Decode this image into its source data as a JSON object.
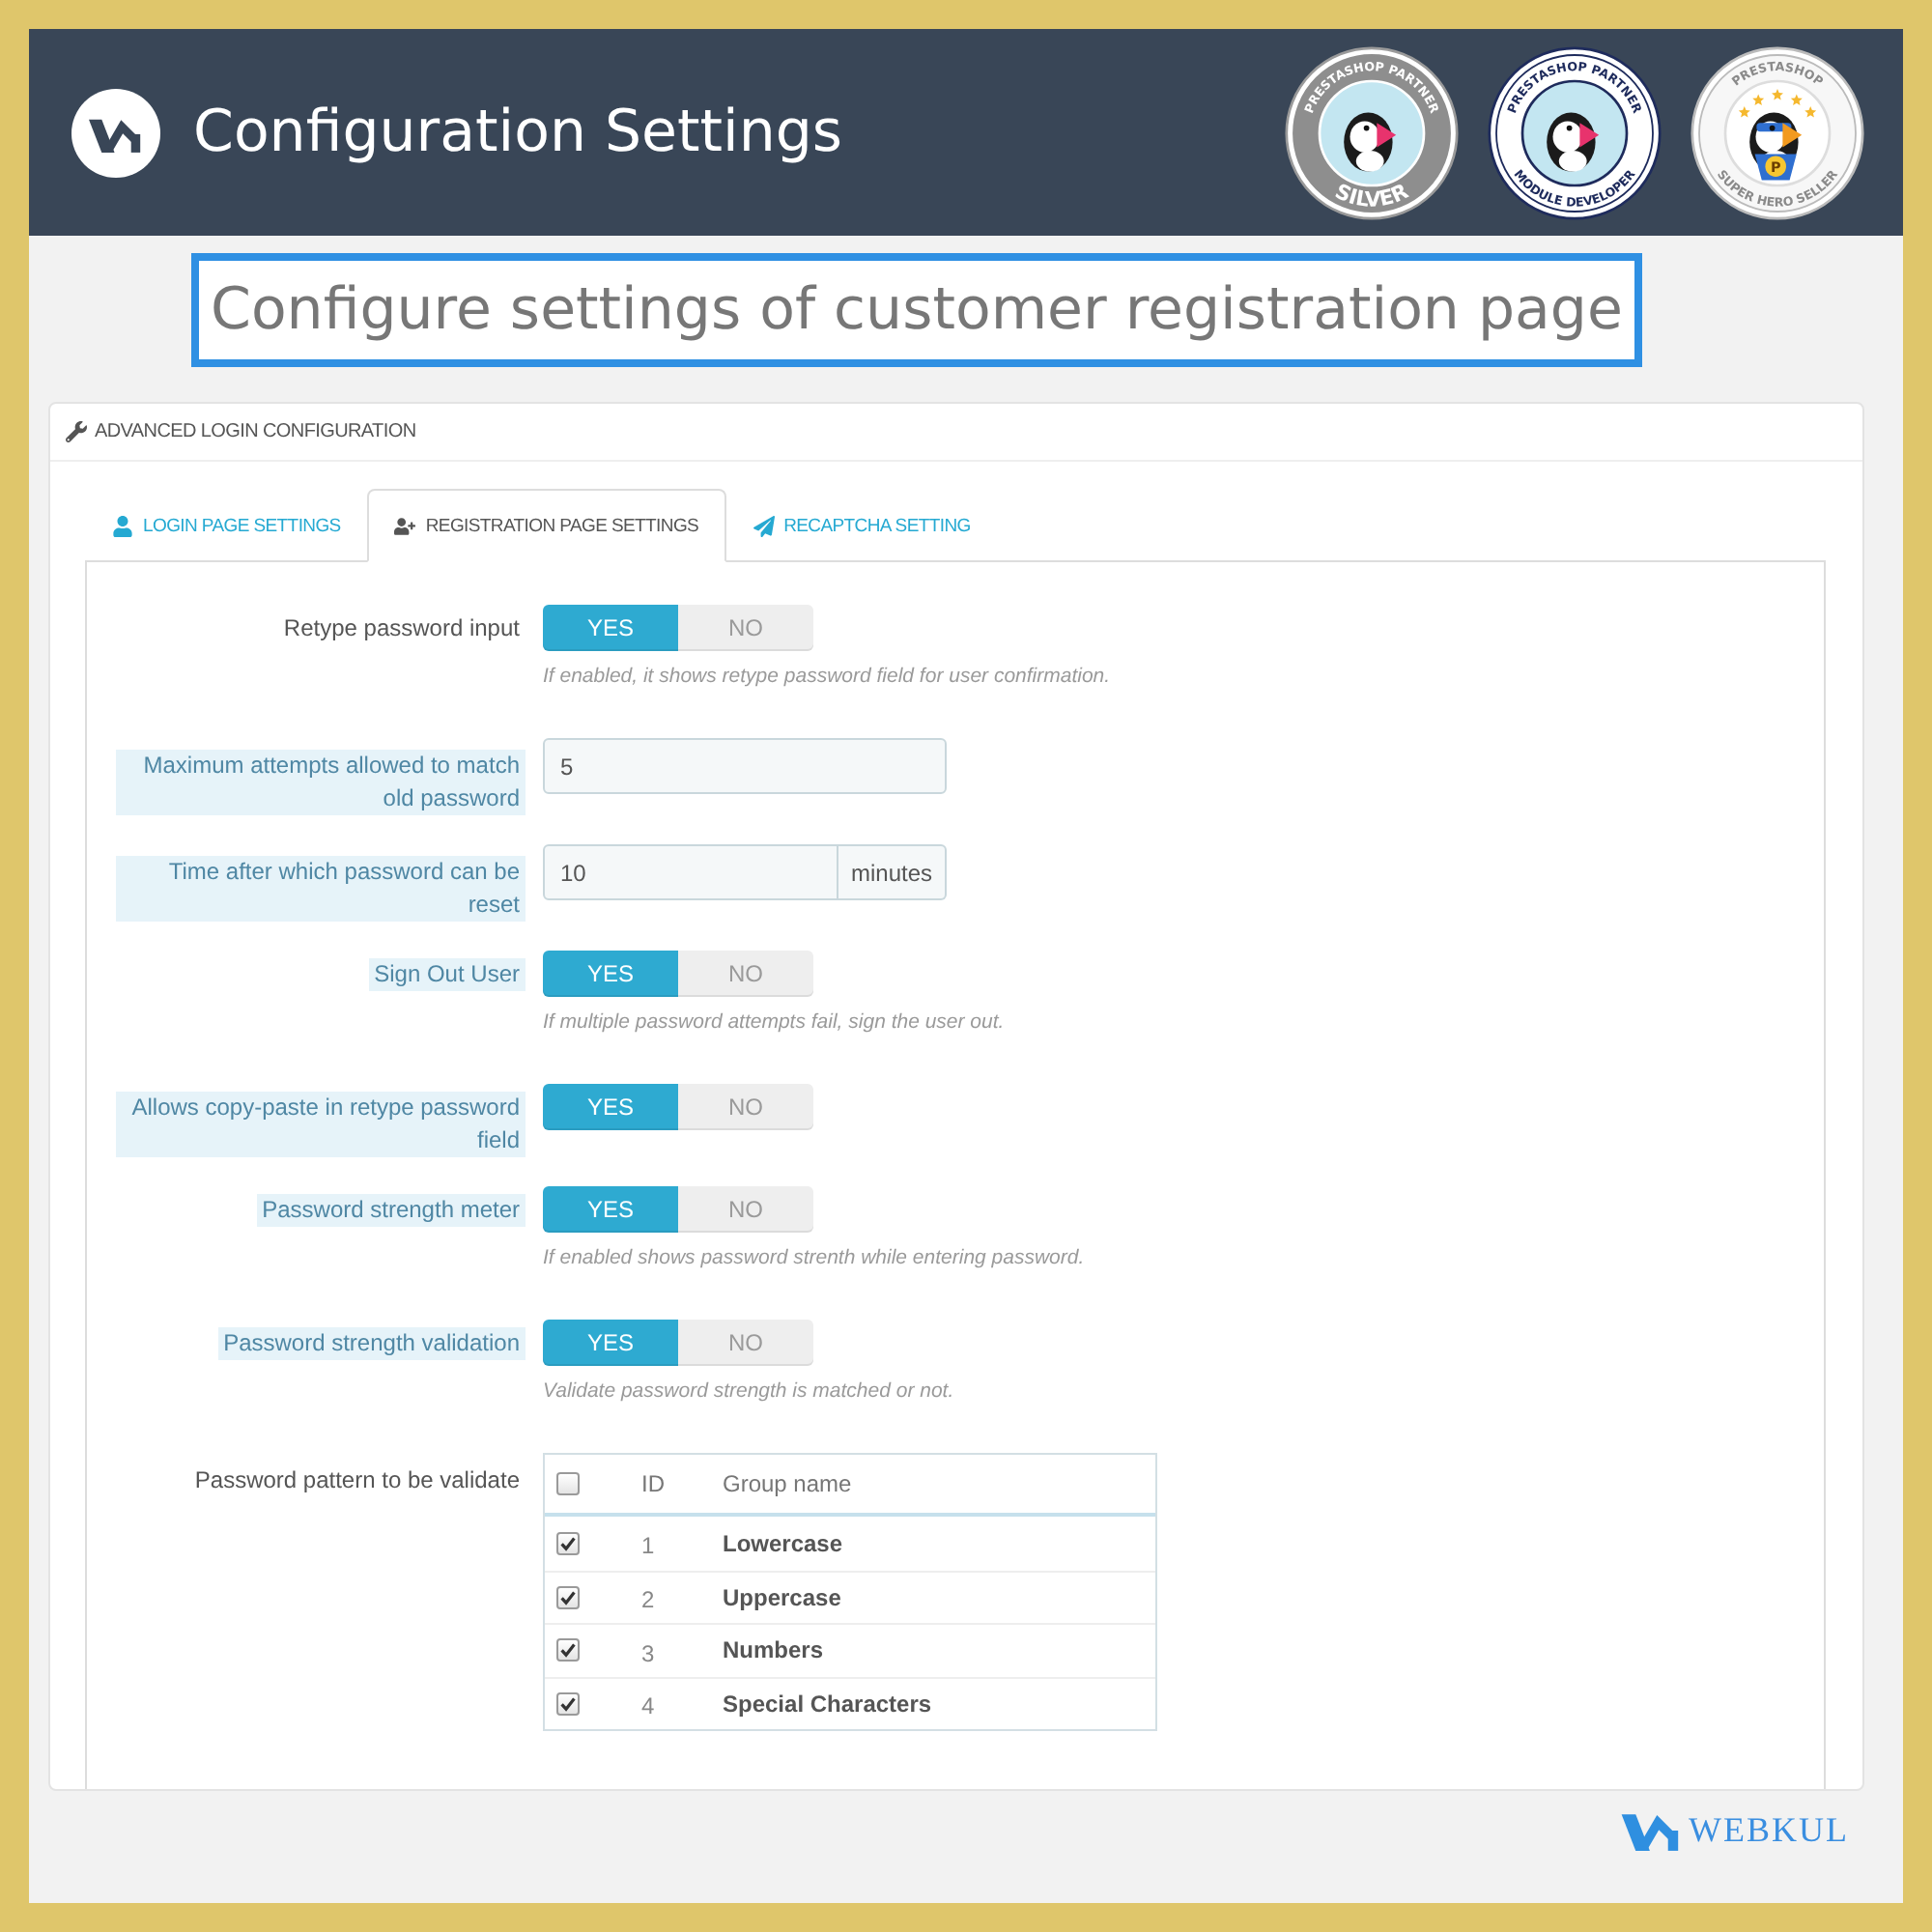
{
  "header": {
    "title": "Configuration Settings",
    "badges": [
      {
        "kind": "silver",
        "top_text": "PRESTASHOP PARTNER",
        "bottom_text": "SILVER"
      },
      {
        "kind": "developer",
        "top_text": "PRESTASHOP PARTNER",
        "bottom_text": "MODULE DEVELOPER"
      },
      {
        "kind": "hero",
        "top_text": "PRESTASHOP",
        "bottom_text": "SUPER HERO SELLER",
        "emblem": "P"
      }
    ]
  },
  "subtitle": "Configure settings of customer registration page",
  "panel": {
    "title": "ADVANCED LOGIN CONFIGURATION",
    "tabs": [
      {
        "label": "LOGIN PAGE SETTINGS",
        "selected": false
      },
      {
        "label": "REGISTRATION PAGE SETTINGS",
        "selected": true
      },
      {
        "label": "RECAPTCHA SETTING",
        "selected": false
      }
    ]
  },
  "form_rows": [
    {
      "kind": "toggle",
      "label": "Retype password input",
      "hint": false,
      "options": [
        {
          "label": "YES",
          "selected": true
        },
        {
          "label": "NO",
          "selected": false
        }
      ],
      "help": "If enabled, it shows retype password field for user confirmation."
    },
    {
      "kind": "input",
      "label": "Maximum attempts allowed to match old password",
      "hint": true,
      "value": "5"
    },
    {
      "kind": "input",
      "label": "Time after which password can be reset",
      "hint": true,
      "value": "10",
      "addon": "minutes"
    },
    {
      "kind": "toggle",
      "label": "Sign Out User",
      "hint": true,
      "options": [
        {
          "label": "YES",
          "selected": true
        },
        {
          "label": "NO",
          "selected": false
        }
      ],
      "help": "If multiple password attempts fail, sign the user out."
    },
    {
      "kind": "toggle",
      "label": "Allows copy-paste in retype password field",
      "hint": true,
      "options": [
        {
          "label": "YES",
          "selected": true
        },
        {
          "label": "NO",
          "selected": false
        }
      ]
    },
    {
      "kind": "toggle",
      "label": "Password strength meter",
      "hint": true,
      "options": [
        {
          "label": "YES",
          "selected": true
        },
        {
          "label": "NO",
          "selected": false
        }
      ],
      "help": "If enabled shows password strenth while entering password."
    },
    {
      "kind": "toggle",
      "label": "Password strength validation",
      "hint": true,
      "options": [
        {
          "label": "YES",
          "selected": true
        },
        {
          "label": "NO",
          "selected": false
        }
      ],
      "help": "Validate password strength is matched or not."
    },
    {
      "kind": "table",
      "label": "Password pattern to be validate",
      "hint": false,
      "table": {
        "select_all_checked": false,
        "columns": [
          "ID",
          "Group name"
        ],
        "rows": [
          {
            "checked": true,
            "id": "1",
            "name": "Lowercase"
          },
          {
            "checked": true,
            "id": "2",
            "name": "Uppercase"
          },
          {
            "checked": true,
            "id": "3",
            "name": "Numbers"
          },
          {
            "checked": true,
            "id": "4",
            "name": "Special Characters"
          }
        ]
      }
    }
  ],
  "footer": {
    "brand": "WEBKUL"
  }
}
